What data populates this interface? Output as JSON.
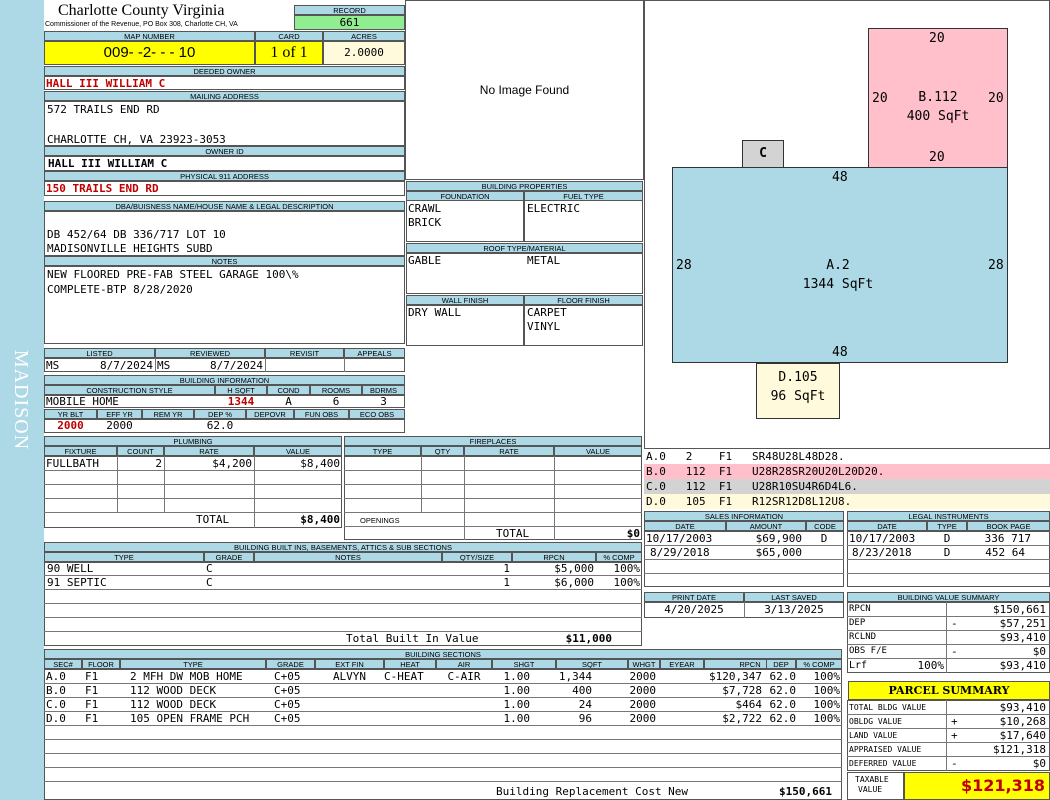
{
  "side": {
    "label": "MADISON"
  },
  "header": {
    "county": "Charlotte County Virginia",
    "subtitle": "Commissioner of the Revenue, PO Box 308, Charlotte CH, VA",
    "record_label": "RECORD",
    "record": "661"
  },
  "map": {
    "map_label": "MAP NUMBER",
    "map_number": "009- -2- - - 10",
    "card_label": "CARD",
    "card": "1 of 1",
    "acres_label": "ACRES",
    "acres": "2.0000"
  },
  "owner": {
    "deeded_label": "DEEDED OWNER",
    "deeded": "HALL III WILLIAM C",
    "mailing_label": "MAILING ADDRESS",
    "mail1": "572 TRAILS END RD",
    "mail2": "CHARLOTTE CH, VA 23923-3053",
    "ownerid_label": "OWNER ID",
    "ownerid": "HALL III WILLIAM C",
    "phys_label": "PHYSICAL 911 ADDRESS",
    "phys": "150 TRAILS END RD"
  },
  "legal": {
    "label": "DBA/BUISNESS NAME/HOUSE NAME & LEGAL DESCRIPTION",
    "line1": "DB 452/64 DB 336/717 LOT 10",
    "line2": "MADISONVILLE HEIGHTS SUBD",
    "notes_label": "NOTES",
    "note1": "NEW FLOORED PRE-FAB STEEL GARAGE 100\\%",
    "note2": "COMPLETE-BTP 8/28/2020"
  },
  "photo": {
    "text": "No Image Found"
  },
  "bprops": {
    "label": "BUILDING PROPERTIES",
    "foundation_label": "FOUNDATION",
    "fuel_label": "FUEL TYPE",
    "foundation1": "CRAWL",
    "foundation2": "BRICK",
    "fuel": "ELECTRIC",
    "roof_label": "ROOF TYPE/MATERIAL",
    "roof_type": "GABLE",
    "roof_mat": "METAL",
    "wall_label": "WALL FINISH",
    "floor_label": "FLOOR FINISH",
    "wall": "DRY WALL",
    "floor1": "CARPET",
    "floor2": "VINYL"
  },
  "review": {
    "listed_label": "LISTED",
    "reviewed_label": "REVIEWED",
    "revisit_label": "REVISIT",
    "appeals_label": "APPEALS",
    "listed_by": "MS",
    "listed": "8/7/2024",
    "reviewed_by": "MS",
    "reviewed": "8/7/2024"
  },
  "binfo": {
    "label": "BUILDING INFORMATION",
    "cs_label": "CONSTRUCTION STYLE",
    "hsqft_label": "H SQFT",
    "cond_label": "COND",
    "rooms_label": "ROOMS",
    "bdrms_label": "BDRMS",
    "style": "MOBILE HOME",
    "hsqft": "1344",
    "cond": "A",
    "rooms": "6",
    "bdrms": "3",
    "yrblt_label": "YR BLT",
    "effyr_label": "EFF YR",
    "remyr_label": "REM YR",
    "dep_label": "DEP %",
    "depovr_label": "DEPOVR",
    "funobs_label": "FUN OBS",
    "ecoobs_label": "ECO OBS",
    "yrblt": "2000",
    "effyr": "2000",
    "dep": "62.0"
  },
  "plumbing": {
    "label": "PLUMBING",
    "h_fixture": "FIXTURE",
    "h_count": "COUNT",
    "h_rate": "RATE",
    "h_value": "VALUE",
    "fixture": "FULLBATH",
    "count": "2",
    "rate": "$4,200",
    "value": "$8,400",
    "total_label": "TOTAL",
    "total": "$8,400"
  },
  "fireplaces": {
    "label": "FIREPLACES",
    "h_type": "TYPE",
    "h_qty": "QTY",
    "h_rate": "RATE",
    "h_value": "VALUE",
    "openings": "OPENINGS",
    "total_label": "TOTAL",
    "total": "$0"
  },
  "builtins": {
    "label": "BUILDING BUILT INS, BASEMENTS, ATTICS & SUB SECTIONS",
    "h_type": "TYPE",
    "h_grade": "GRADE",
    "h_notes": "NOTES",
    "h_qty": "QTY/SIZE",
    "h_rpcn": "RPCN",
    "h_comp": "% COMP",
    "rows": [
      {
        "type": "90 WELL",
        "grade": "C",
        "qty": "1",
        "rpcn": "$5,000",
        "comp": "100%"
      },
      {
        "type": "91 SEPTIC",
        "grade": "C",
        "qty": "1",
        "rpcn": "$6,000",
        "comp": "100%"
      }
    ],
    "total_label": "Total Built In Value",
    "total": "$11,000"
  },
  "sketch": {
    "b_top": "20",
    "b_left": "20",
    "b_right": "20",
    "b_bottom": "20",
    "b_label": "B.112",
    "b_area": "400 SqFt",
    "c_label": "C",
    "a_top": "48",
    "a_left": "28",
    "a_right": "28",
    "a_bottom": "48",
    "a_label": "A.2",
    "a_area": "1344 SqFt",
    "d_label": "D.105",
    "d_area": "96 SqFt"
  },
  "legend": [
    {
      "text": "A.0   2    F1   SR48U28L48D28.",
      "color": "#ffffff"
    },
    {
      "text": "B.0   112  F1   U28R28SR20U20L20D20.",
      "color": "#ffc0cb"
    },
    {
      "text": "C.0   112  F1   U28R10SU4R6D4L6.",
      "color": "#d3d3d3"
    },
    {
      "text": "D.0   105  F1   R12SR12D8L12U8.",
      "color": "#fffadc"
    }
  ],
  "sales": {
    "label": "SALES INFORMATION",
    "h_date": "DATE",
    "h_amount": "AMOUNT",
    "h_code": "CODE",
    "rows": [
      {
        "date": "10/17/2003",
        "amount": "$69,900",
        "code": "D"
      },
      {
        "date": "8/29/2018",
        "amount": "$65,000",
        "code": ""
      }
    ]
  },
  "legalinst": {
    "label": "LEGAL INSTRUMENTS",
    "h_date": "DATE",
    "h_type": "TYPE",
    "h_book": "BOOK PAGE",
    "rows": [
      {
        "date": "10/17/2003",
        "type": "D",
        "book": "336 717"
      },
      {
        "date": "8/23/2018",
        "type": "D",
        "book": "452 64"
      }
    ]
  },
  "dates": {
    "print_label": "PRINT DATE",
    "saved_label": "LAST SAVED",
    "print": "4/20/2025",
    "saved": "3/13/2025"
  },
  "bvs": {
    "label": "BUILDING VALUE SUMMARY",
    "rpcn_label": "RPCN",
    "rpcn": "$150,661",
    "dep_label": "DEP",
    "dep_sign": "-",
    "dep": "$57,251",
    "rclnd_label": "RCLND",
    "rclnd": "$93,410",
    "obs_label": "OBS F/E",
    "obs_sign": "-",
    "obs": "$0",
    "lrf_label": "Lrf",
    "lrf_pct": "100%",
    "lrf": "$93,410"
  },
  "parcel": {
    "title": "PARCEL SUMMARY",
    "tbv_label": "TOTAL BLDG VALUE",
    "tbv": "$93,410",
    "ob_label": "OBLDG VALUE",
    "ob_sign": "+",
    "ob": "$10,268",
    "land_label": "LAND VALUE",
    "land_sign": "+",
    "land": "$17,640",
    "appr_label": "APPRAISED VALUE",
    "appr": "$121,318",
    "def_label": "DEFERRED VALUE",
    "def_sign": "-",
    "def": "$0",
    "tax_label1": "TAXABLE",
    "tax_label2": "VALUE",
    "taxable": "$121,318"
  },
  "sections": {
    "label": "BUILDING SECTIONS",
    "h": [
      "SEC#",
      "FLOOR",
      "TYPE",
      "GRADE",
      "EXT FIN",
      "HEAT",
      "AIR",
      "SHGT",
      "SQFT",
      "WHGT",
      "EYEAR",
      "RPCN",
      "DEP",
      "% COMP"
    ],
    "rows": [
      [
        "A.0",
        "F1",
        "2 MFH DW MOB HOME",
        "C+05",
        "ALVYN",
        "C-HEAT",
        "C-AIR",
        "1.00",
        "1,344",
        "",
        "2000",
        "$120,347",
        "62.0",
        "100%"
      ],
      [
        "B.0",
        "F1",
        "112 WOOD DECK",
        "C+05",
        "",
        "",
        "",
        "1.00",
        "400",
        "",
        "2000",
        "$7,728",
        "62.0",
        "100%"
      ],
      [
        "C.0",
        "F1",
        "112 WOOD DECK",
        "C+05",
        "",
        "",
        "",
        "1.00",
        "24",
        "",
        "2000",
        "$464",
        "62.0",
        "100%"
      ],
      [
        "D.0",
        "F1",
        "105 OPEN FRAME PCH",
        "C+05",
        "",
        "",
        "",
        "1.00",
        "96",
        "",
        "2000",
        "$2,722",
        "62.0",
        "100%"
      ]
    ],
    "total_label": "Building Replacement Cost New",
    "total": "$150,661"
  }
}
